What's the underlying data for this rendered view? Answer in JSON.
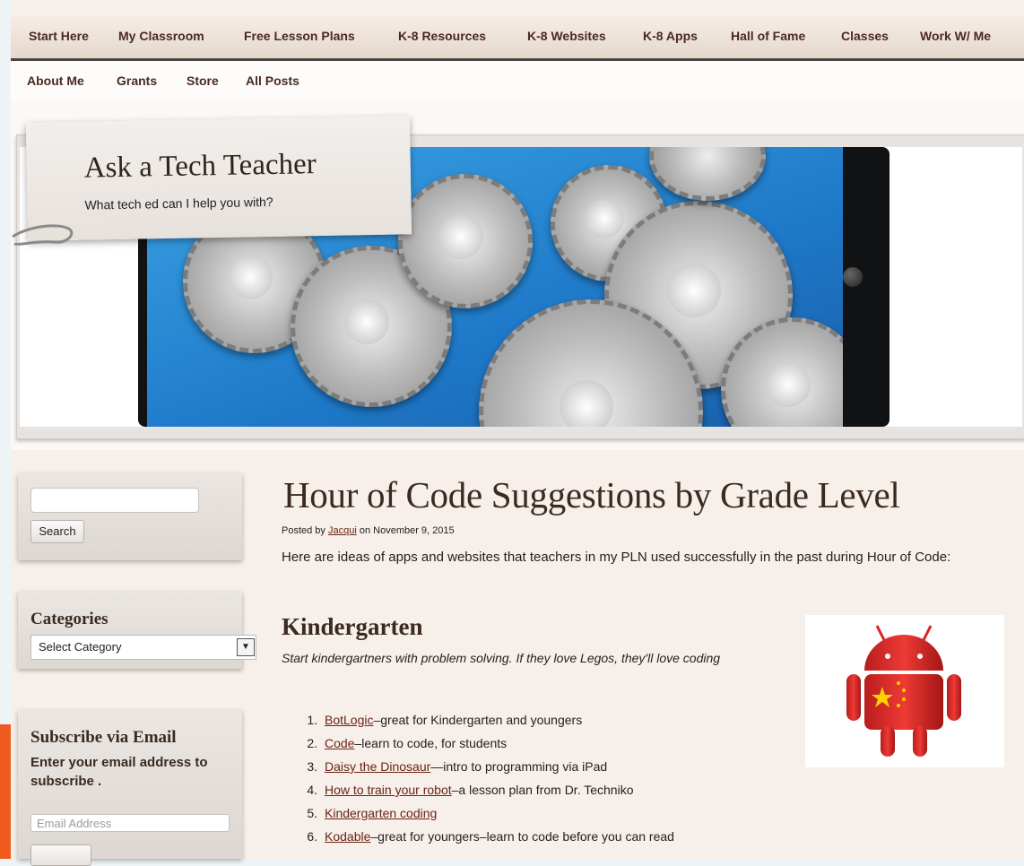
{
  "nav": {
    "primary": [
      "Start Here",
      "My Classroom",
      "Free Lesson Plans",
      "K-8 Resources",
      "K-8 Websites",
      "K-8 Apps",
      "Hall of Fame",
      "Classes",
      "Work W/ Me"
    ],
    "secondary": [
      "About Me",
      "Grants",
      "Store",
      "All Posts"
    ]
  },
  "site": {
    "title": "Ask a Tech Teacher",
    "description": "What tech ed can I help you with?"
  },
  "sidebar": {
    "search": {
      "value": "",
      "button": "Search"
    },
    "categories": {
      "title": "Categories",
      "selected": "Select Category"
    },
    "subscribe": {
      "title": "Subscribe via Email",
      "text": "Enter your email address to subscribe .",
      "placeholder": "Email Address"
    }
  },
  "post": {
    "title": "Hour of Code Suggestions by Grade Level",
    "meta_prefix": "Posted by",
    "author": "Jacqui",
    "meta_suffix": "on November 9, 2015",
    "intro": "Here are ideas of apps and websites that teachers in my PLN used successfully in the past during Hour of Code:",
    "section": {
      "heading": "Kindergarten",
      "lead": "Start kindergartners with problem solving. If they love Legos, they'll love coding",
      "items": [
        {
          "num": "1.",
          "link": "BotLogic",
          "rest": "–great for Kindergarten and youngers"
        },
        {
          "num": "2.",
          "link": "Code",
          "rest": "–learn to code, for students"
        },
        {
          "num": "3.",
          "link": "Daisy the Dinosaur",
          "rest": "—intro to programming via iPad"
        },
        {
          "num": "4.",
          "link": "How to train your robot",
          "rest": "–a lesson plan from Dr. Techniko"
        },
        {
          "num": "5.",
          "link": "Kindergarten coding",
          "rest": ""
        },
        {
          "num": "6.",
          "link": "Kodable",
          "rest": "–great for youngers–learn to code before you can read"
        }
      ]
    }
  },
  "colors": {
    "accent_orange": "#f05a1e",
    "title_brown": "#3a2a20",
    "link": "#6b2415"
  }
}
